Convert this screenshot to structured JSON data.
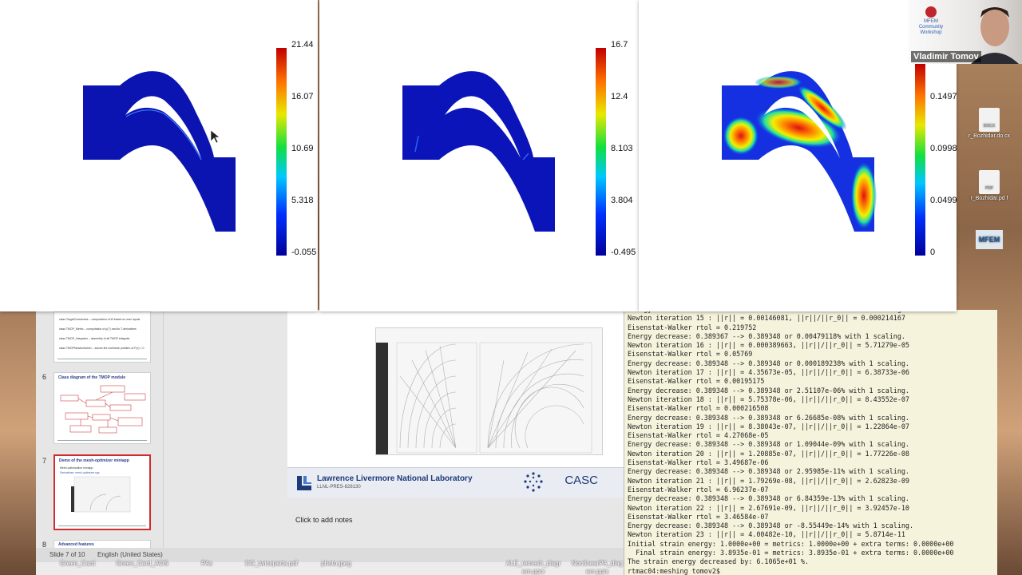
{
  "plots": [
    {
      "max_label": "21.44",
      "t1": "16.07",
      "t2": "10.69",
      "t3": "5.318",
      "min_label": "-0.055"
    },
    {
      "max_label": "16.7",
      "t1": "12.4",
      "t2": "8.103",
      "t3": "3.804",
      "min_label": "-0.495"
    },
    {
      "max_label": "",
      "t1": "0.1497",
      "t2": "0.0998",
      "t3": "0.0499",
      "min_label": "0"
    }
  ],
  "video": {
    "participant_name": "Vladimir Tomov",
    "badge_lines": [
      "MFEM",
      "Community",
      "Workshop"
    ]
  },
  "powerpoint": {
    "thumbnails": [
      {
        "num": "",
        "title": "",
        "lines": [
          "class TargetConstructor – computation of W based on user inputs",
          "class TMOP_Metric – computation of μ(T) and its T-derivatives",
          "class TMOP_Integrator – assembly of all TMOP integrals",
          "class TMOPNewtonSolver – solves the nonlinear problem of F(x) = 0"
        ]
      },
      {
        "num": "6",
        "title": "Class diagram of the TMOP module",
        "lines": []
      },
      {
        "num": "7",
        "title": "Demo of the mesh-optimizer miniapp",
        "lines": [
          "Mesh optimization miniapp",
          "Derivatives: mesh-optimizer.cpp"
        ]
      },
      {
        "num": "8",
        "title": "Advanced features",
        "lines": []
      }
    ],
    "footer_org": "Lawrence Livermore National Laboratory",
    "footer_code": "LLNL-PRES-828130",
    "footer_logo_text": "CASC",
    "notes_placeholder": "Click to add notes",
    "status_slide": "Slide 7 of 10",
    "status_language": "English (United States)"
  },
  "desktop_files": [
    {
      "label": "Green_Card"
    },
    {
      "label": "Green_Card_AOS"
    },
    {
      "label": "PAs"
    },
    {
      "label": "DG_twiceparts.pdf"
    },
    {
      "label": "photo.jpeg"
    },
    {
      "label": "ALE_remesh_diagr am.pptx"
    },
    {
      "label": "NonlinearPA_diag am.pptx"
    }
  ],
  "desktop_right": [
    {
      "badge": "DOCX",
      "label": "r_Bozhidar.do cx"
    },
    {
      "badge": "PDF",
      "label": "r_Bozhidar.pd f"
    },
    {
      "badge": "MFEM",
      "label": ""
    }
  ],
  "terminal_lines": [
    "Energy decrease: 0.389393 --> 0.389367 or 0.00667794% with 1 scaling.",
    "Newton iteration 15 : ||r|| = 0.00146081, ||r||/||r_0|| = 0.000214167",
    "Eisenstat-Walker rtol = 0.219752",
    "Energy decrease: 0.389367 --> 0.389348 or 0.00479118% with 1 scaling.",
    "Newton iteration 16 : ||r|| = 0.000389663, ||r||/||r_0|| = 5.71279e-05",
    "Eisenstat-Walker rtol = 0.05769",
    "Energy decrease: 0.389348 --> 0.389348 or 0.000189238% with 1 scaling.",
    "Newton iteration 17 : ||r|| = 4.35673e-05, ||r||/||r_0|| = 6.38733e-06",
    "Eisenstat-Walker rtol = 0.00195175",
    "Energy decrease: 0.389348 --> 0.389348 or 2.51107e-06% with 1 scaling.",
    "Newton iteration 18 : ||r|| = 5.75378e-06, ||r||/||r_0|| = 8.43552e-07",
    "Eisenstat-Walker rtol = 0.000216508",
    "Energy decrease: 0.389348 --> 0.389348 or 6.26685e-08% with 1 scaling.",
    "Newton iteration 19 : ||r|| = 8.38043e-07, ||r||/||r_0|| = 1.22864e-07",
    "Eisenstat-Walker rtol = 4.27068e-05",
    "Energy decrease: 0.389348 --> 0.389348 or 1.09044e-09% with 1 scaling.",
    "Newton iteration 20 : ||r|| = 1.20885e-07, ||r||/||r_0|| = 1.77226e-08",
    "Eisenstat-Walker rtol = 3.49687e-06",
    "Energy decrease: 0.389348 --> 0.389348 or 2.95985e-11% with 1 scaling.",
    "Newton iteration 21 : ||r|| = 1.79269e-08, ||r||/||r_0|| = 2.62823e-09",
    "Eisenstat-Walker rtol = 6.96237e-07",
    "Energy decrease: 0.389348 --> 0.389348 or 6.84359e-13% with 1 scaling.",
    "Newton iteration 22 : ||r|| = 2.67691e-09, ||r||/||r_0|| = 3.92457e-10",
    "Eisenstat-Walker rtol = 3.46584e-07",
    "Energy decrease: 0.389348 --> 0.389348 or -8.55449e-14% with 1 scaling.",
    "Newton iteration 23 : ||r|| = 4.00482e-10, ||r||/||r_0|| = 5.8714e-11",
    "Initial strain energy: 1.0000e+00 = metrics: 1.0000e+00 + extra terms: 0.0000e+00",
    "  Final strain energy: 3.8935e-01 = metrics: 3.8935e-01 + extra terms: 0.0000e+00",
    "The strain energy decreased by: 6.1065e+01 %.",
    "rtmac04:meshing tomov2$ "
  ],
  "colors": {
    "field_low": "#0a0aa0",
    "field_high": "#e01010",
    "terminal_bg": "#f5f3dc",
    "slide_selection": "#d12b2b"
  }
}
